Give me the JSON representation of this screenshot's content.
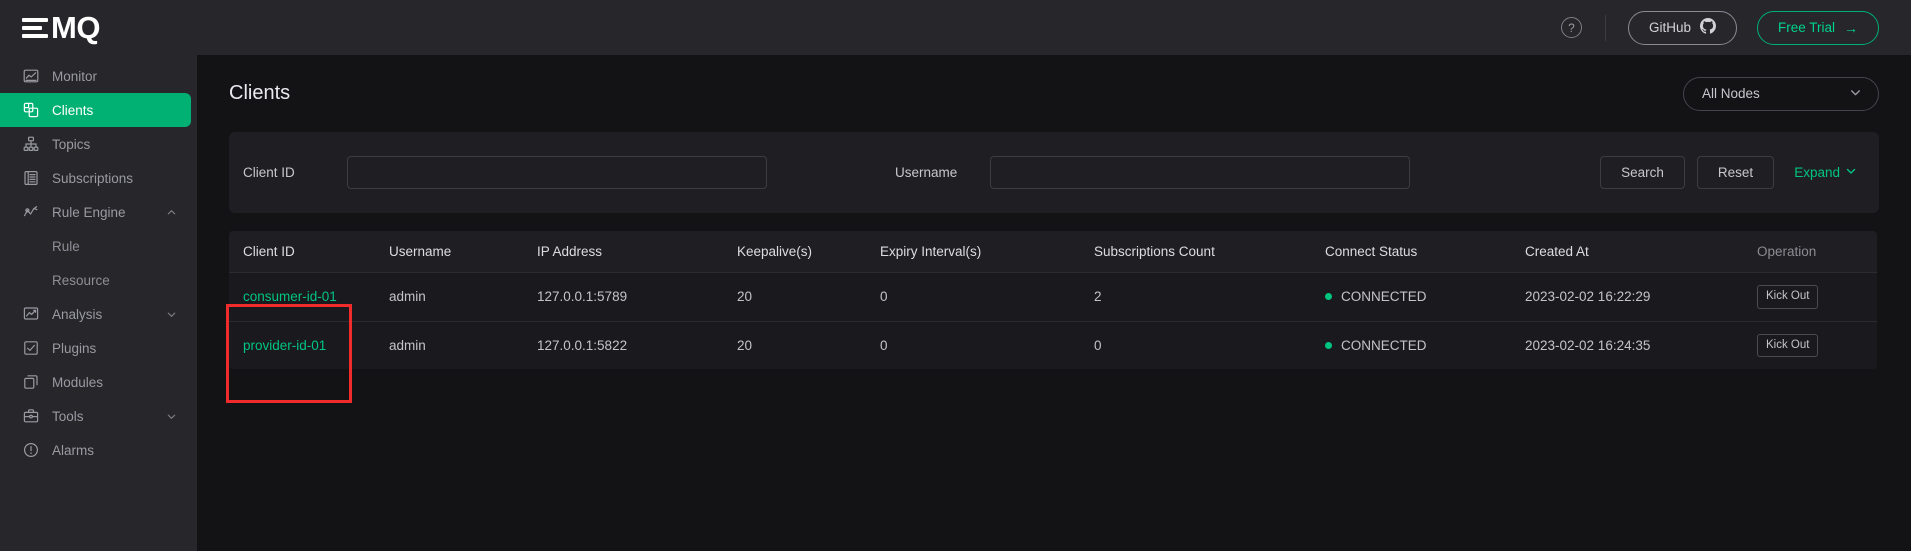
{
  "brand": {
    "logo_text": "MQ",
    "logo_mark": "three-bars-e"
  },
  "sidebar": {
    "items": [
      {
        "label": "Monitor",
        "icon": "chart-monitor-icon",
        "active": false,
        "expandable": false
      },
      {
        "label": "Clients",
        "icon": "clients-stack-icon",
        "active": true,
        "expandable": false
      },
      {
        "label": "Topics",
        "icon": "topics-tree-icon",
        "active": false,
        "expandable": false
      },
      {
        "label": "Subscriptions",
        "icon": "subscriptions-list-icon",
        "active": false,
        "expandable": false
      },
      {
        "label": "Rule Engine",
        "icon": "rule-engine-icon",
        "active": false,
        "expandable": true,
        "expanded": true
      },
      {
        "label": "Rule",
        "icon": "",
        "sub": true
      },
      {
        "label": "Resource",
        "icon": "",
        "sub": true
      },
      {
        "label": "Analysis",
        "icon": "analysis-trend-icon",
        "active": false,
        "expandable": true,
        "expanded": false
      },
      {
        "label": "Plugins",
        "icon": "plugins-check-icon",
        "active": false,
        "expandable": false
      },
      {
        "label": "Modules",
        "icon": "modules-copy-icon",
        "active": false,
        "expandable": false
      },
      {
        "label": "Tools",
        "icon": "tools-briefcase-icon",
        "active": false,
        "expandable": true,
        "expanded": false
      },
      {
        "label": "Alarms",
        "icon": "alarms-alert-icon",
        "active": false,
        "expandable": false
      }
    ]
  },
  "topbar": {
    "help_icon": "help-circle-icon",
    "github_label": "GitHub",
    "github_icon": "github-icon",
    "trial_label": "Free Trial",
    "trial_arrow": "→"
  },
  "page": {
    "title": "Clients",
    "node_filter_value": "All Nodes"
  },
  "filters": {
    "client_id_label": "Client ID",
    "client_id_value": "",
    "client_id_placeholder": "",
    "username_label": "Username",
    "username_value": "",
    "username_placeholder": "",
    "search_label": "Search",
    "reset_label": "Reset",
    "expand_label": "Expand"
  },
  "table": {
    "columns": [
      "Client ID",
      "Username",
      "IP Address",
      "Keepalive(s)",
      "Expiry Interval(s)",
      "Subscriptions Count",
      "Connect Status",
      "Created At",
      "Operation"
    ],
    "rows": [
      {
        "client_id": "consumer-id-01",
        "username": "admin",
        "ip_address": "127.0.0.1:5789",
        "keepalive": "20",
        "expiry_interval": "0",
        "subscriptions_count": "2",
        "connect_status": "CONNECTED",
        "created_at": "2023-02-02 16:22:29",
        "operation": "Kick Out"
      },
      {
        "client_id": "provider-id-01",
        "username": "admin",
        "ip_address": "127.0.0.1:5822",
        "keepalive": "20",
        "expiry_interval": "0",
        "subscriptions_count": "0",
        "connect_status": "CONNECTED",
        "created_at": "2023-02-02 16:24:35",
        "operation": "Kick Out"
      }
    ]
  },
  "annotation": {
    "type": "red-rectangle-highlight",
    "target": "client-id-column-cells"
  },
  "colors": {
    "accent_green": "#00b173",
    "link_green": "#00c47f",
    "sidebar_bg": "#26262b",
    "page_bg": "#131316",
    "panel_bg": "#1f1f23",
    "annotation_red": "#ef2b2b"
  }
}
